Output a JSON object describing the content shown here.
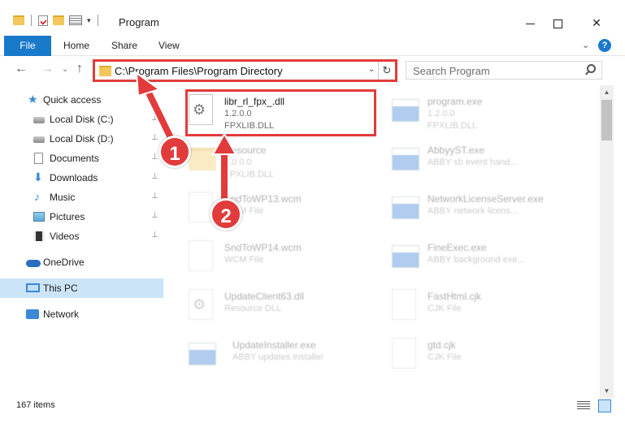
{
  "window": {
    "title": "Program",
    "qat_caret": "▾",
    "minimize_label": "",
    "close_label": "✕"
  },
  "ribbon": {
    "tabs": [
      "File",
      "Home",
      "Share",
      "View"
    ],
    "collapse_chevron": "⌄",
    "help": "?"
  },
  "nav": {
    "back": "←",
    "forward": "→",
    "history": "⌄",
    "up": "↑",
    "address": "C:\\Program Files\\Program Directory",
    "address_dropdown": "⌄",
    "refresh": "↻",
    "search_placeholder": "Search Program"
  },
  "sidebar": {
    "items": [
      {
        "label": "Quick access",
        "icon": "star-icon"
      },
      {
        "label": "Local Disk (C:)",
        "icon": "drive-icon",
        "pinned": true
      },
      {
        "label": "Local Disk (D:)",
        "icon": "drive-icon",
        "pinned": true
      },
      {
        "label": "Documents",
        "icon": "document-icon",
        "pinned": true
      },
      {
        "label": "Downloads",
        "icon": "download-icon",
        "pinned": true
      },
      {
        "label": "Music",
        "icon": "music-icon",
        "pinned": true
      },
      {
        "label": "Pictures",
        "icon": "picture-icon",
        "pinned": true
      },
      {
        "label": "Videos",
        "icon": "video-icon",
        "pinned": true
      },
      {
        "label": "OneDrive",
        "icon": "cloud-icon"
      },
      {
        "label": "This PC",
        "icon": "computer-icon",
        "selected": true
      },
      {
        "label": "Network",
        "icon": "network-icon"
      }
    ],
    "pin_glyph": "📌"
  },
  "files": {
    "left": [
      {
        "name": "libr_rl_fpx_.dll",
        "type": "1.2.0.0",
        "desc": "FPXLIB.DLL",
        "icon": "dll"
      },
      {
        "name": "Resource",
        "type": "1.0.0.0",
        "desc": "FPXLIB.DLL",
        "icon": "folder"
      },
      {
        "name": "SndToWP13.wcm",
        "type": "WCM File",
        "desc": "",
        "icon": "blank"
      },
      {
        "name": "SndToWP14.wcm",
        "type": "WCM File",
        "desc": "",
        "icon": "blank"
      },
      {
        "name": "UpdateClient63.dll",
        "type": "Resource DLL",
        "desc": "",
        "icon": "dll"
      },
      {
        "name": "UpdateInstaller.exe",
        "type": "ABBY updates installer",
        "desc": "",
        "icon": "exe"
      }
    ],
    "right": [
      {
        "name": "program.exe",
        "type": "1.2.0.0",
        "desc": "FPXLIB.DLL",
        "icon": "exe"
      },
      {
        "name": "AbbyyST.exe",
        "type": "ABBY sb event hand...",
        "desc": "",
        "icon": "exe"
      },
      {
        "name": "NetworkLicenseServer.exe",
        "type": "ABBY network licens...",
        "desc": "",
        "icon": "exe"
      },
      {
        "name": "FineExec.exe",
        "type": "ABBY background exe...",
        "desc": "",
        "icon": "exe"
      },
      {
        "name": "FastHtml.cjk",
        "type": "CJK File",
        "desc": "",
        "icon": "blank"
      },
      {
        "name": "gtd.cjk",
        "type": "CJK File",
        "desc": "",
        "icon": "blank"
      }
    ]
  },
  "status": {
    "item_count": "167 items"
  },
  "annotations": {
    "badge_1": "1",
    "badge_2": "2",
    "accent_color": "#e23b3b"
  },
  "colors": {
    "file_tab": "#1979ca",
    "selected_nav": "#cce4f7",
    "highlight": "#e23b3b"
  }
}
